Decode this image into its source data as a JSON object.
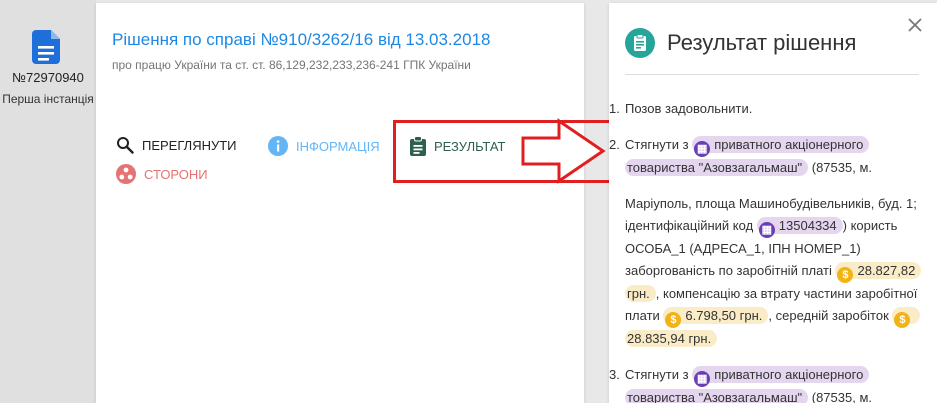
{
  "rail": {
    "case_number": "№72970940",
    "instance": "Перша інстанція"
  },
  "card": {
    "title": "Рішення по справі №910/3262/16 від 13.03.2018",
    "subtitle": "про працю України та ст. ст. 86,129,232,233,236-241 ГПК України",
    "buttons": {
      "view": "ПЕРЕГЛЯНУТИ",
      "info": "ІНФОРМАЦІЯ",
      "result": "РЕЗУЛЬТАТ",
      "parties": "СТОРОНИ"
    }
  },
  "panel": {
    "title": "Результат рішення",
    "items": [
      {
        "n": "1.",
        "text": "Позов задовольнити."
      },
      {
        "n": "2.",
        "lead": "Стягнути з",
        "org": "приватного акціонерного товариства \"Азовзагальмаш\"",
        "addr1": "(87535, м.",
        "addr2": "Маріуполь, площа Машинобудівельників, буд. 1; ідентифікаційний код",
        "code": "13504334",
        "mid": ") користь ОСОБА_1 (АДРЕСА_1, ІПН НОМЕР_1) заборгованість по заробітній платі",
        "sum1": "28.827,82 грн.",
        "t1": ", компенсацію за втрату частини заробітної плати",
        "sum2": "6.798,50 грн.",
        "t2": ", середній заробіток",
        "sum3": "28.835,94 грн."
      },
      {
        "n": "3.",
        "lead": "Стягнути з",
        "org": "приватного акціонерного товариства \"Азовзагальмаш\"",
        "addr1": "(87535, м."
      }
    ]
  },
  "colors": {
    "accent_blue": "#1e88e5",
    "result_green": "#2e5f4f",
    "annotation_red": "#e02020",
    "org_chip": "#e5d6ef",
    "money_chip": "#fbecc8"
  }
}
